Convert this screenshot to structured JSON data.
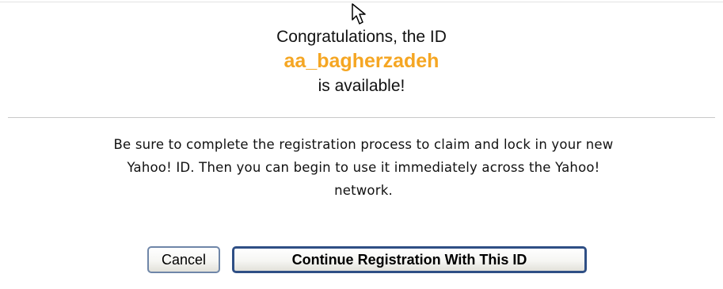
{
  "congrats": {
    "line1": "Congratulations, the ID",
    "yahoo_id": "aa_bagherzadeh",
    "line3": "is available!"
  },
  "message": {
    "line1": "Be sure to complete the registration process to claim and lock in your new",
    "line2": "Yahoo! ID. Then you can begin to use it immediately across the Yahoo!",
    "line3": "network."
  },
  "buttons": {
    "cancel_label": "Cancel",
    "continue_label": "Continue Registration With This ID"
  },
  "colors": {
    "id_highlight": "#f5a623",
    "button_border": "#2f4f85"
  },
  "icons": {
    "pointer": "mouse-pointer-icon"
  }
}
